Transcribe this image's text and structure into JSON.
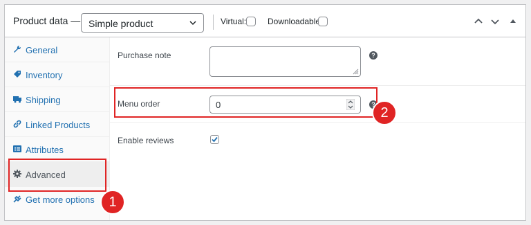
{
  "header": {
    "title": "Product data —",
    "product_type": "Simple product",
    "virtual_label": "Virtual:",
    "downloadable_label": "Downloadable:",
    "virtual_checked": false,
    "downloadable_checked": false
  },
  "sidebar": {
    "items": [
      {
        "label": "General",
        "icon": "wrench-icon"
      },
      {
        "label": "Inventory",
        "icon": "tag-icon"
      },
      {
        "label": "Shipping",
        "icon": "truck-icon"
      },
      {
        "label": "Linked Products",
        "icon": "link-icon"
      },
      {
        "label": "Attributes",
        "icon": "list-icon"
      },
      {
        "label": "Advanced",
        "icon": "gear-icon",
        "active": true
      },
      {
        "label": "Get more options",
        "icon": "plugin-icon"
      }
    ]
  },
  "main": {
    "purchase_note_label": "Purchase note",
    "purchase_note_value": "",
    "menu_order_label": "Menu order",
    "menu_order_value": "0",
    "enable_reviews_label": "Enable reviews",
    "enable_reviews_checked": true
  },
  "annotations": {
    "badge_1": "1",
    "badge_2": "2",
    "highlight_color": "#e02424"
  }
}
